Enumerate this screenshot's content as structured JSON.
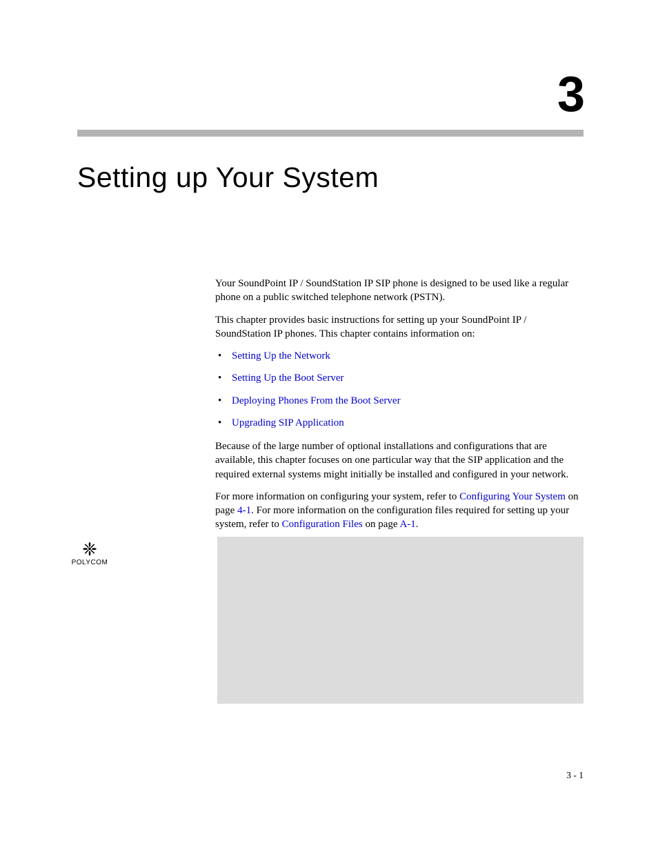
{
  "chapter": {
    "number": "3",
    "title": "Setting up Your System"
  },
  "paragraphs": {
    "p1": "Your SoundPoint IP / SoundStation IP SIP phone is designed to be used like a regular phone on a public switched telephone network (PSTN).",
    "p2": "This chapter provides basic instructions for setting up your SoundPoint IP / SoundStation IP phones. This chapter contains information on:",
    "p3": "Because of the large number of optional installations and configurations that are available, this chapter focuses on one particular way that the SIP application and the required external systems might initially be installed and configured in your network.",
    "p4_a": "For more information on configuring your system, refer to ",
    "p4_link1": "Configuring Your System",
    "p4_b": " on page ",
    "p4_link2": "4-1",
    "p4_c": ". For more information on the configuration files required for setting up your system, refer to ",
    "p4_link3": "Configuration Files",
    "p4_d": " on page ",
    "p4_link4": "A-1",
    "p4_e": "."
  },
  "bullets": [
    "Setting Up the Network",
    "Setting Up the Boot Server",
    "Deploying Phones From the Boot Server",
    "Upgrading SIP Application"
  ],
  "logo": {
    "glyph": "❈",
    "text": "POLYCOM"
  },
  "page_number": "3 - 1"
}
